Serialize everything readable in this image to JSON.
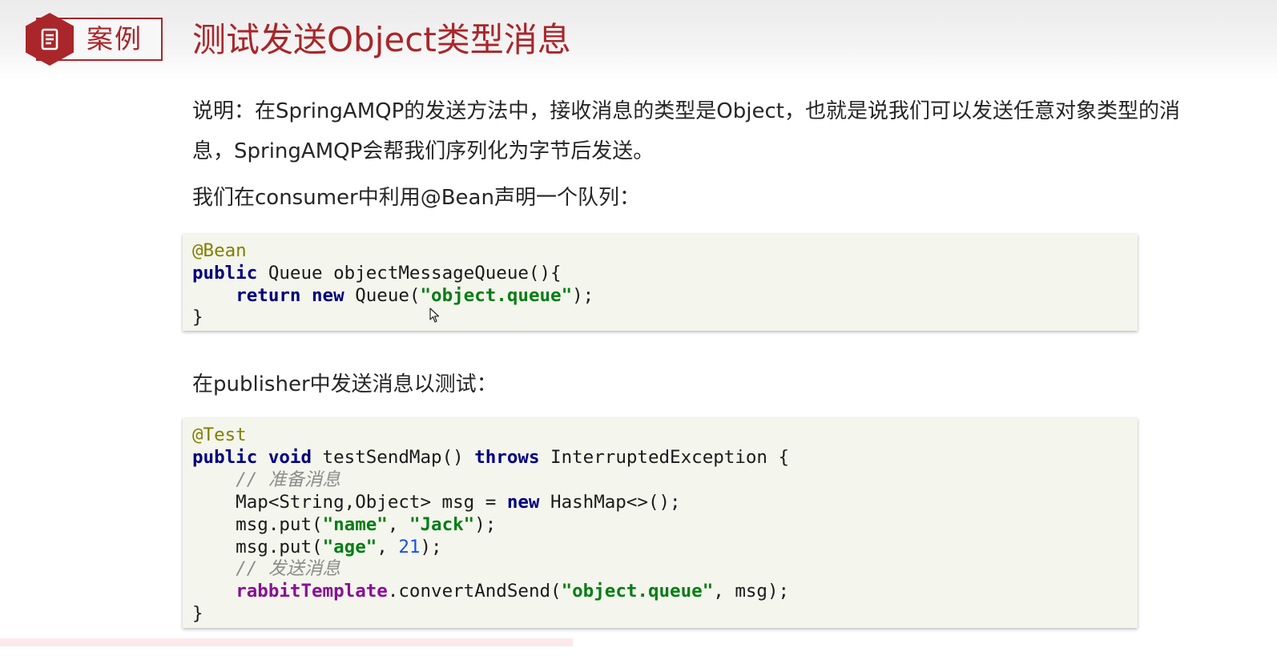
{
  "header": {
    "badge_label": "案例",
    "title": "测试发送Object类型消息"
  },
  "content": {
    "description": "说明：在SpringAMQP的发送方法中，接收消息的类型是Object，也就是说我们可以发送任意对象类型的消息，SpringAMQP会帮我们序列化为字节后发送。",
    "consumer_intro": "我们在consumer中利用@Bean声明一个队列：",
    "publisher_intro": "在publisher中发送消息以测试："
  },
  "code_blocks": [
    {
      "lines": [
        [
          {
            "t": "@Bean",
            "k": "ann"
          }
        ],
        [
          {
            "t": "public",
            "k": "kw"
          },
          {
            "t": " Queue objectMessageQueue(){",
            "k": "plain"
          }
        ],
        [
          {
            "t": "    ",
            "k": "plain"
          },
          {
            "t": "return",
            "k": "kw"
          },
          {
            "t": " ",
            "k": "plain"
          },
          {
            "t": "new",
            "k": "kw"
          },
          {
            "t": " Queue(",
            "k": "plain"
          },
          {
            "t": "\"object.queue\"",
            "k": "str"
          },
          {
            "t": ");",
            "k": "plain"
          }
        ],
        [
          {
            "t": "}",
            "k": "plain"
          }
        ]
      ]
    },
    {
      "lines": [
        [
          {
            "t": "@Test",
            "k": "ann"
          }
        ],
        [
          {
            "t": "public",
            "k": "kw"
          },
          {
            "t": " ",
            "k": "plain"
          },
          {
            "t": "void",
            "k": "kw"
          },
          {
            "t": " testSendMap() ",
            "k": "plain"
          },
          {
            "t": "throws",
            "k": "kw"
          },
          {
            "t": " InterruptedException {",
            "k": "plain"
          }
        ],
        [
          {
            "t": "    ",
            "k": "plain"
          },
          {
            "t": "// 准备消息",
            "k": "com"
          }
        ],
        [
          {
            "t": "    Map<String,Object> msg = ",
            "k": "plain"
          },
          {
            "t": "new",
            "k": "kw"
          },
          {
            "t": " HashMap<>();",
            "k": "plain"
          }
        ],
        [
          {
            "t": "    msg.put(",
            "k": "plain"
          },
          {
            "t": "\"name\"",
            "k": "str"
          },
          {
            "t": ", ",
            "k": "plain"
          },
          {
            "t": "\"Jack\"",
            "k": "str"
          },
          {
            "t": ");",
            "k": "plain"
          }
        ],
        [
          {
            "t": "    msg.put(",
            "k": "plain"
          },
          {
            "t": "\"age\"",
            "k": "str"
          },
          {
            "t": ", ",
            "k": "plain"
          },
          {
            "t": "21",
            "k": "num"
          },
          {
            "t": ");",
            "k": "plain"
          }
        ],
        [
          {
            "t": "    ",
            "k": "plain"
          },
          {
            "t": "// 发送消息",
            "k": "com"
          }
        ],
        [
          {
            "t": "    ",
            "k": "plain"
          },
          {
            "t": "rabbitTemplate",
            "k": "field"
          },
          {
            "t": ".convertAndSend(",
            "k": "plain"
          },
          {
            "t": "\"object.queue\"",
            "k": "str"
          },
          {
            "t": ", msg);",
            "k": "plain"
          }
        ],
        [
          {
            "t": "}",
            "k": "plain"
          }
        ]
      ]
    }
  ],
  "icons": {
    "badge_icon": "document-icon",
    "pointer": "mouse-pointer-icon"
  },
  "colors": {
    "brand": "#a9262a",
    "code_background": "#f4f5ec"
  }
}
